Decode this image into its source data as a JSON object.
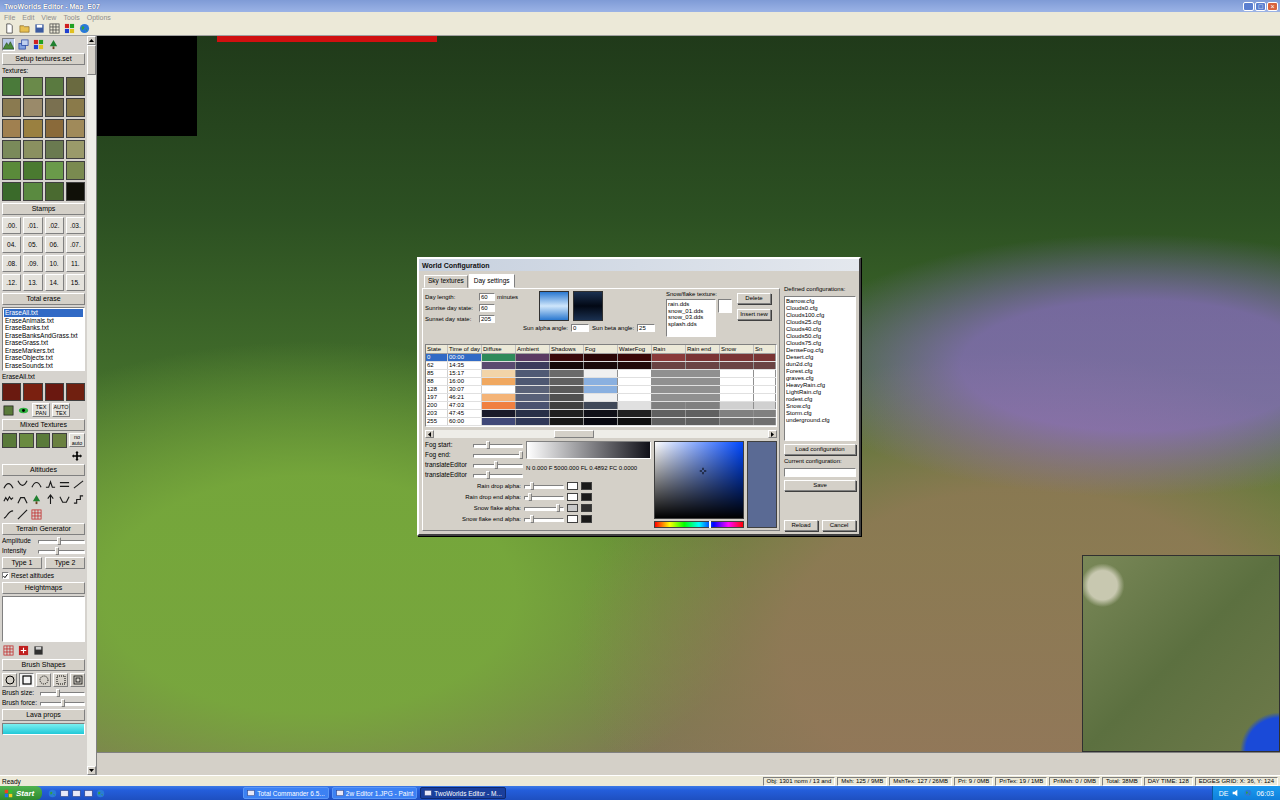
{
  "window": {
    "title": "TwoWorlds Editor - Map_E07",
    "controls": [
      "_",
      "□",
      "×"
    ]
  },
  "menu": [
    {
      "label": "File",
      "disabled": true
    },
    {
      "label": "Edit",
      "disabled": true
    },
    {
      "label": "View",
      "disabled": true
    },
    {
      "label": "Tools",
      "disabled": true
    },
    {
      "label": "Options",
      "disabled": true
    }
  ],
  "sidebar": {
    "scroll_level": 0,
    "setup_button": "Setup textures.set",
    "textures_label": "Textures:",
    "textures": [
      {
        "color": "#4a7a3a"
      },
      {
        "color": "#6a8a4a"
      },
      {
        "color": "#5a7a40"
      },
      {
        "color": "#6a6a40"
      },
      {
        "color": "#8a7a50"
      },
      {
        "color": "#9a8a6a"
      },
      {
        "color": "#7a7050"
      },
      {
        "color": "#8a7a4a"
      },
      {
        "color": "#a08050"
      },
      {
        "color": "#9a8040"
      },
      {
        "color": "#8a6a3a"
      },
      {
        "color": "#a08a5a"
      },
      {
        "color": "#7a8a5a"
      },
      {
        "color": "#8a9060"
      },
      {
        "color": "#6a7a50"
      },
      {
        "color": "#9a9a6a"
      }
    ],
    "textures_extra": [
      {
        "color": "#5a8a3a"
      },
      {
        "color": "#4a7a30"
      },
      {
        "color": "#6a9a4a"
      },
      {
        "color": "#7a8a50"
      },
      {
        "color": "#3a6a2a"
      },
      {
        "color": "#5a8a40"
      },
      {
        "color": "#4a6a30"
      },
      {
        "color": "#101008"
      }
    ],
    "stamps": {
      "title": "Stamps",
      "items": [
        ".00.",
        ".01.",
        ".02.",
        ".03.",
        "04.",
        "05.",
        "06.",
        ".07.",
        ".08.",
        ".09.",
        "10.",
        "11.",
        ".12.",
        "13.",
        "14.",
        "15."
      ]
    },
    "erase": {
      "title": "Total erase",
      "files": [
        {
          "name": "EraseAll.txt",
          "selected": true
        },
        {
          "name": "EraseAnimals.txt",
          "selected": false
        },
        {
          "name": "EraseBanks.txt",
          "selected": false
        },
        {
          "name": "EraseBanksAndGrass.txt",
          "selected": false
        },
        {
          "name": "EraseGrass.txt",
          "selected": false
        },
        {
          "name": "EraseMarkers.txt",
          "selected": false
        },
        {
          "name": "EraseObjects.txt",
          "selected": false
        },
        {
          "name": "EraseSounds.txt",
          "selected": false
        }
      ],
      "current": "EraseAll.txt",
      "swatches": [
        {
          "color": "#6a1a10"
        },
        {
          "color": "#7a2010"
        },
        {
          "color": "#6a1810"
        },
        {
          "color": "#702010"
        }
      ]
    },
    "tex_buttons": [
      "TEX PAN",
      "AUTO TEX"
    ],
    "mixed": {
      "title": "Mixed Textures",
      "swatches": [
        {
          "color": "#5a7a3a"
        },
        {
          "color": "#6a8a40"
        },
        {
          "color": "#5a7a3a"
        },
        {
          "color": "#6a8040"
        }
      ],
      "button": "no auto"
    },
    "altitudes": {
      "title": "Altitudes"
    },
    "terrain": {
      "title": "Terrain Generator",
      "sliders": [
        {
          "label": "Amplitude",
          "level": 0.45
        },
        {
          "label": "Intensity",
          "level": 0.4
        }
      ],
      "buttons": [
        "Type 1",
        "Type 2"
      ],
      "reset": {
        "label": "Reset altitudes",
        "checked": true
      }
    },
    "heightmaps": {
      "title": "Heightmaps",
      "items": []
    },
    "brush": {
      "title": "Brush Shapes",
      "shapes": [
        {
          "kind": "circle",
          "selected": false
        },
        {
          "kind": "square",
          "selected": true
        },
        {
          "kind": "soft-circle",
          "selected": false
        },
        {
          "kind": "soft-square",
          "selected": false
        },
        {
          "kind": "frame",
          "selected": false
        }
      ],
      "sliders": [
        {
          "label": "Brush size:",
          "level": 0.4
        },
        {
          "label": "Brush force:",
          "level": 0.5
        }
      ]
    },
    "lava": {
      "title": "Lava props"
    }
  },
  "dialog": {
    "title": "World Configuration",
    "tabs": [
      {
        "label": "Sky textures",
        "selected": false
      },
      {
        "label": "Day settings",
        "selected": true
      }
    ],
    "fields": [
      {
        "label": "Day length:",
        "value": "60",
        "unit": "minutes"
      },
      {
        "label": "Sunrise day state:",
        "value": "60",
        "unit": ""
      },
      {
        "label": "Sunset day state:",
        "value": "205",
        "unit": ""
      }
    ],
    "sky_swatches": [
      {
        "top": "#cfe6fb",
        "bottom": "#2a78d0"
      },
      {
        "top": "#020814",
        "bottom": "#1a3050"
      }
    ],
    "sun": [
      {
        "label": "Sun alpha angle:",
        "value": "0"
      },
      {
        "label": "Sun beta angle:",
        "value": "25"
      }
    ],
    "snow_texture": {
      "label": "Snow/flake texture:",
      "items": [
        "rain.dds",
        "snow_01.dds",
        "snow_03.dds",
        "splash.dds"
      ]
    },
    "buttons_top": [
      "Delete",
      "Insert new"
    ],
    "table": {
      "columns": [
        "State",
        "Time of day",
        "Diffuse",
        "Ambient",
        "Shadows",
        "Fog",
        "WaterFog",
        "Rain",
        "Rain end",
        "Snow",
        "Sn"
      ],
      "scroll_level": 0.42,
      "rows": [
        {
          "state": "0",
          "time": "00:00",
          "selected": true,
          "colors": [
            "#2f8a5a",
            "#5a3a62",
            "#3a0a0a",
            "#2a0606",
            "#3a0808",
            "#8a3a3a",
            "#7a3434",
            "#7a3434",
            "#7a3434"
          ]
        },
        {
          "state": "62",
          "time": "14:35",
          "selected": false,
          "colors": [
            "#5a4a70",
            "#3c3c5c",
            "#140808",
            "#1a0a0a",
            "#200a0a",
            "#6a4444",
            "#6a4444",
            "#6a4444",
            "#6a4444"
          ]
        },
        {
          "state": "85",
          "time": "15:17",
          "selected": false,
          "colors": [
            "#f2d4a8",
            "#505a74",
            "#6a6a6a",
            "#f0f0f0",
            "#ffffff",
            "#909090",
            "#909090",
            "#ffffff",
            "#ffffff"
          ]
        },
        {
          "state": "88",
          "time": "16:00",
          "selected": false,
          "colors": [
            "#f0a860",
            "#4e5872",
            "#606060",
            "#8ab0e0",
            "#ffffff",
            "#909090",
            "#909090",
            "#ffffff",
            "#ffffff"
          ]
        },
        {
          "state": "128",
          "time": "30:07",
          "selected": false,
          "colors": [
            "#ffffff",
            "#5a6278",
            "#5a5a5a",
            "#8ab0e0",
            "#ffffff",
            "#909090",
            "#909090",
            "#ffffff",
            "#ffffff"
          ]
        },
        {
          "state": "197",
          "time": "46:21",
          "selected": false,
          "colors": [
            "#f4b478",
            "#586078",
            "#505050",
            "#f0f0f0",
            "#ffffff",
            "#909090",
            "#909090",
            "#ffffff",
            "#ffffff"
          ]
        },
        {
          "state": "200",
          "time": "47:03",
          "selected": false,
          "colors": [
            "#f08040",
            "#4a5270",
            "#404040",
            "#404858",
            "#e0e0e0",
            "#808080",
            "#808080",
            "#d0d0d0",
            "#d0d0d0"
          ]
        },
        {
          "state": "203",
          "time": "47:45",
          "selected": false,
          "colors": [
            "#1a1a2a",
            "#283048",
            "#202020",
            "#101018",
            "#202020",
            "#606060",
            "#606060",
            "#808080",
            "#808080"
          ]
        },
        {
          "state": "255",
          "time": "60:00",
          "selected": false,
          "colors": [
            "#404878",
            "#303858",
            "#181818",
            "#080810",
            "#101010",
            "#606060",
            "#606060",
            "#707070",
            "#707070"
          ]
        }
      ]
    },
    "fog_sliders": [
      {
        "label": "Fog start:",
        "level": 0.3
      },
      {
        "label": "Fog end:",
        "level": 0.95
      },
      {
        "label": "translateEditor",
        "level": 0.45
      },
      {
        "label": "translateEditor",
        "level": 0.3
      }
    ],
    "fog_gradient": {
      "from": "#ffffff",
      "to": "#101018"
    },
    "fog_readout": "N 0.000 F 5000.000 FL 0.4892 FC 0.0000",
    "picker": {
      "hue": 0.62,
      "x": 0.55,
      "y": 0.38,
      "preview": "#5a6a94"
    },
    "alphas": [
      {
        "label": "Rain drop alpha:",
        "level": 0.2,
        "colors": [
          "#ffffff",
          "#1a1a1a"
        ]
      },
      {
        "label": "Rain drop end alpha:",
        "level": 0.15,
        "colors": [
          "#ffffff",
          "#1a1a1a"
        ]
      },
      {
        "label": "Snow flake alpha:",
        "level": 0.85,
        "colors": [
          "#c8c8c8",
          "#303030"
        ]
      },
      {
        "label": "Snow flake end alpha:",
        "level": 0.2,
        "colors": [
          "#ffffff",
          "#1a1a1a"
        ]
      }
    ],
    "configs": {
      "label": "Defined configurations:",
      "items": [
        "Barrow.cfg",
        "Clouds0.cfg",
        "Clouds100.cfg",
        "Clouds25.cfg",
        "Clouds40.cfg",
        "Clouds50.cfg",
        "Clouds75.cfg",
        "DenseFog.cfg",
        "Desert.cfg",
        "dun2d.cfg",
        "Forest.cfg",
        "graves.cfg",
        "HeavyRain.cfg",
        "LightRain.cfg",
        "rodest.cfg",
        "Snow.cfg",
        "Storm.cfg",
        "underground.cfg"
      ]
    },
    "load": "Load configuration",
    "current_label": "Current configuration:",
    "current_value": "",
    "save": "Save",
    "reload": "Reload",
    "cancel": "Cancel"
  },
  "status_bar": {
    "text": "Ready",
    "segments": [
      "Obj: 1301 norm / 13 and",
      "Msh: 125 / 9MB",
      "MshTex: 127 / 26MB",
      "Pri: 9 / 0MB",
      "PriTex: 19 / 1MB",
      "PriMsh: 0 / 0MB",
      "Total: 38MB",
      "DAY TIME: 128",
      "EDGES GRID: X: 36, Y: 124"
    ]
  },
  "taskbar": {
    "start": "Start",
    "tasks": [
      {
        "label": "Total Commander 6.5...",
        "selected": false
      },
      {
        "label": "2w Editor 1.JPG - Paint",
        "selected": false
      },
      {
        "label": "TwoWorlds Editor - M...",
        "selected": true
      }
    ],
    "language": "DE",
    "clock": "06:03"
  }
}
